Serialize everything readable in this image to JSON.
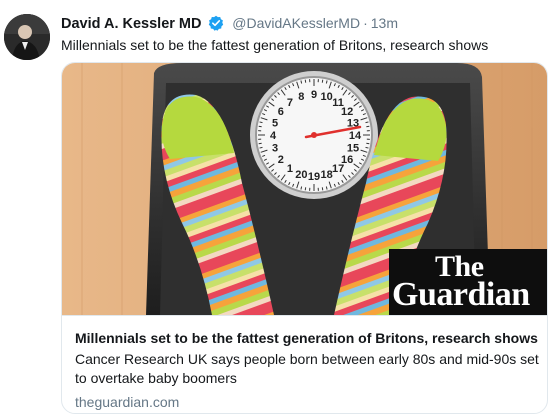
{
  "tweet": {
    "author_name": "David A. Kessler MD",
    "handle": "@DavidAKesslerMD",
    "separator": "·",
    "time": "13m",
    "text": "Millennials set to be the fattest generation of Britons, research shows"
  },
  "card": {
    "title": "Millennials set to be the fattest generation of Britons, research shows",
    "description": "Cancer Research UK says people born between early 80s and mid-90s set to overtake baby boomers",
    "domain": "theguardian.com",
    "logo_line1": "The",
    "logo_line2": "Guardian"
  },
  "scale_numbers": [
    "5",
    "6",
    "7",
    "8",
    "9",
    "10",
    "11",
    "12",
    "13",
    "14",
    "15",
    "16",
    "17",
    "18",
    "19",
    "20",
    "1",
    "2",
    "3",
    "4"
  ],
  "colors": {
    "verified_blue": "#1da1f2",
    "text_secondary": "#657786",
    "border": "#e1e8ed",
    "guardian_bg": "#0e0e0e"
  }
}
